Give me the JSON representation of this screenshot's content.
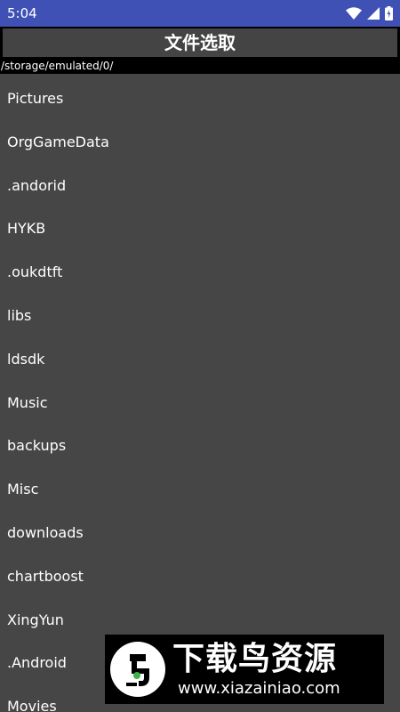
{
  "status_bar": {
    "time": "5:04",
    "icons": [
      "wifi-icon",
      "cellular-signal-icon",
      "battery-icon"
    ]
  },
  "header": {
    "title": "文件选取"
  },
  "path": "/storage/emulated/0/",
  "file_list": {
    "items": [
      "Pictures",
      "OrgGameData",
      ".andorid",
      "HYKB",
      ".oukdtft",
      "libs",
      "ldsdk",
      "Music",
      "backups",
      "Misc",
      "downloads",
      "chartboost",
      "XingYun",
      ".Android",
      "Movies"
    ]
  },
  "watermark": {
    "title": "下载鸟资源",
    "url": "www.xiazainiao.com"
  },
  "colors": {
    "status_bar": "#3f51b5",
    "title_bar": "#444444",
    "list_background": "#464646",
    "text": "#ffffff",
    "logo_green": "#3cb44b"
  }
}
